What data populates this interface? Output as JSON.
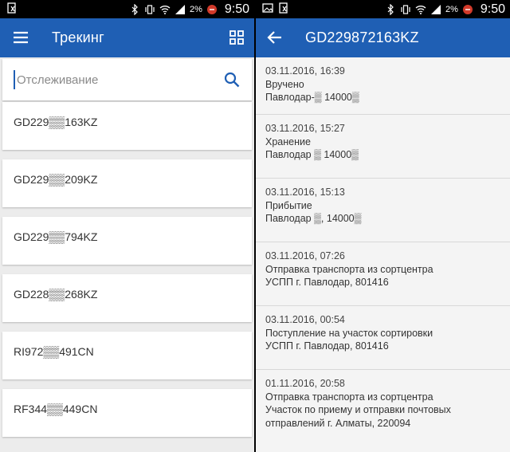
{
  "status_bar": {
    "battery": "2%",
    "time": "9:50"
  },
  "left_screen": {
    "title": "Трекинг",
    "search": {
      "placeholder": "Отслеживание",
      "value": ""
    },
    "tracking_numbers": [
      "GD229▒▒163KZ",
      "GD229▒▒209KZ",
      "GD229▒▒794KZ",
      "GD228▒▒268KZ",
      "RI972▒▒491CN",
      "RF344▒▒449CN"
    ]
  },
  "right_screen": {
    "title": "GD229872163KZ",
    "events": [
      {
        "date": "03.11.2016, 16:39",
        "status": "Вручено",
        "location": "Павлодар-▒ 14000▒"
      },
      {
        "date": "03.11.2016, 15:27",
        "status": "Хранение",
        "location": "Павлодар ▒ 14000▒"
      },
      {
        "date": "03.11.2016, 15:13",
        "status": "Прибытие",
        "location": "Павлодар ▒, 14000▒"
      },
      {
        "date": "03.11.2016, 07:26",
        "status": "Отправка транспорта из сортцентра",
        "location": "УСПП г. Павлодар, 801416"
      },
      {
        "date": "03.11.2016, 00:54",
        "status": "Поступление на участок сортировки",
        "location": "УСПП г. Павлодар, 801416"
      },
      {
        "date": "01.11.2016, 20:58",
        "status": "Отправка транспорта из сортцентра",
        "location": "Участок по приему и отправки почтовых отправлений г. Алматы, 220094"
      }
    ]
  },
  "colors": {
    "app_bar": "#1f5fb4",
    "background": "#ececec",
    "card": "#ffffff"
  },
  "icons": {
    "menu": "hamburger-menu-icon",
    "grid": "grid-view-icon",
    "search": "search-icon",
    "back": "arrow-back-icon"
  }
}
